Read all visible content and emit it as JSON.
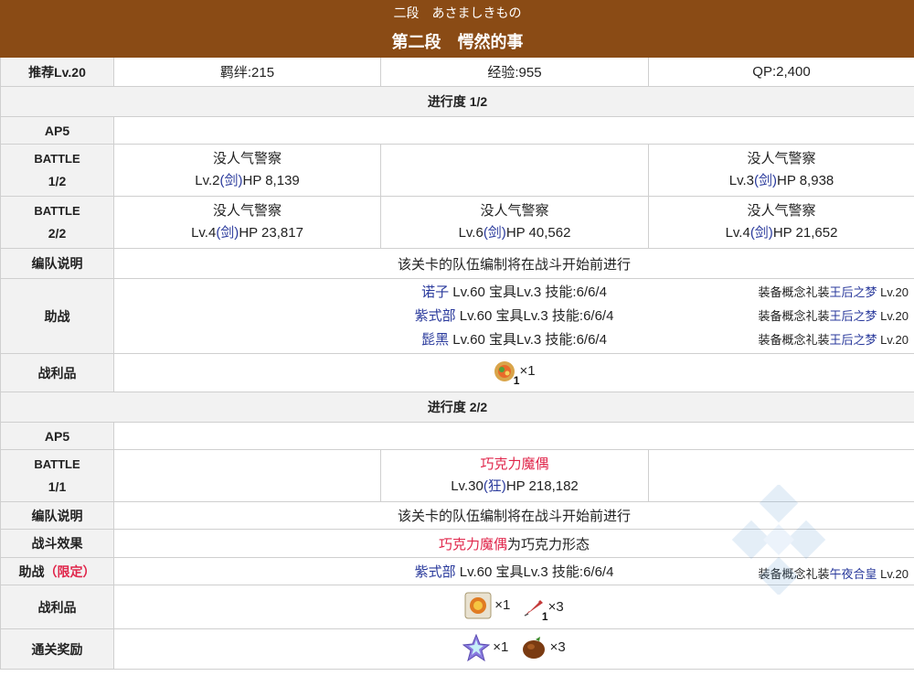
{
  "header": {
    "subtitle": "二段　あさましきもの",
    "title": "第二段　愕然的事"
  },
  "rec": {
    "label": "推荐Lv.20",
    "bond": "羁绊:215",
    "exp": "经验:955",
    "qp": "QP:2,400"
  },
  "progress1": {
    "label": "进行度 1/2",
    "ap": "AP5",
    "battle1": {
      "label1": "BATTLE",
      "label2": "1/2",
      "enemies": [
        {
          "name": "没人气警察",
          "lv": "Lv.2",
          "cls": "(剑)",
          "hp": "HP 8,139"
        },
        {
          "name": "没人气警察",
          "lv": "Lv.3",
          "cls": "(剑)",
          "hp": "HP 8,938"
        }
      ]
    },
    "battle2": {
      "label1": "BATTLE",
      "label2": "2/2",
      "enemies": [
        {
          "name": "没人气警察",
          "lv": "Lv.4",
          "cls": "(剑)",
          "hp": "HP 23,817"
        },
        {
          "name": "没人气警察",
          "lv": "Lv.6",
          "cls": "(剑)",
          "hp": "HP 40,562"
        },
        {
          "name": "没人气警察",
          "lv": "Lv.4",
          "cls": "(剑)",
          "hp": "HP 21,652"
        }
      ]
    },
    "formation": {
      "label": "编队说明",
      "text": "该关卡的队伍编制将在战斗开始前进行"
    },
    "support": {
      "label": "助战",
      "rows": [
        {
          "name": "诺子",
          "info": " Lv.60 宝具Lv.3 技能:6/6/4",
          "ce_prefix": "装备概念礼装",
          "ce": "王后之梦",
          "ce_lv": " Lv.20"
        },
        {
          "name": "紫式部",
          "info": " Lv.60 宝具Lv.3 技能:6/6/4",
          "ce_prefix": "装备概念礼装",
          "ce": "王后之梦",
          "ce_lv": " Lv.20"
        },
        {
          "name": "髭黑",
          "info": " Lv.60 宝具Lv.3 技能:6/6/4",
          "ce_prefix": "装备概念礼装",
          "ce": "王后之梦",
          "ce_lv": " Lv.20"
        }
      ]
    },
    "drops": {
      "label": "战利品",
      "items": [
        {
          "icon": "feast-plate-icon",
          "count": "1",
          "mult": "×1"
        }
      ]
    }
  },
  "progress2": {
    "label": "进行度 2/2",
    "ap": "AP5",
    "battle1": {
      "label1": "BATTLE",
      "label2": "1/1",
      "enemy": {
        "name": "巧克力魔偶",
        "lv": "Lv.30",
        "cls": "(狂)",
        "hp": "HP 218,182"
      }
    },
    "formation": {
      "label": "编队说明",
      "text": "该关卡的队伍编制将在战斗开始前进行"
    },
    "effect": {
      "label": "战斗效果",
      "name": "巧克力魔偶",
      "text": "为巧克力形态"
    },
    "support": {
      "label": "助战",
      "limited": "（限定）",
      "name": "紫式部",
      "info": " Lv.60 宝具Lv.3 技能:6/6/4",
      "ce_prefix": "装备概念礼装",
      "ce": "午夜合皇",
      "ce_lv": " Lv.20"
    },
    "drops": {
      "label": "战利品",
      "items": [
        {
          "icon": "craft-essence-card-icon",
          "count": "",
          "mult": "×1"
        },
        {
          "icon": "feather-icon",
          "count": "1",
          "mult": "×3"
        }
      ]
    },
    "rewards": {
      "label": "通关奖励",
      "items": [
        {
          "icon": "saint-quartz-icon",
          "mult": "×1"
        },
        {
          "icon": "chocolate-icon",
          "mult": "×3"
        }
      ]
    }
  },
  "colors": {
    "header_bg": "#8a4b15",
    "servant_name": "#2a3a9c",
    "enemy_highlight": "#e0254a"
  }
}
